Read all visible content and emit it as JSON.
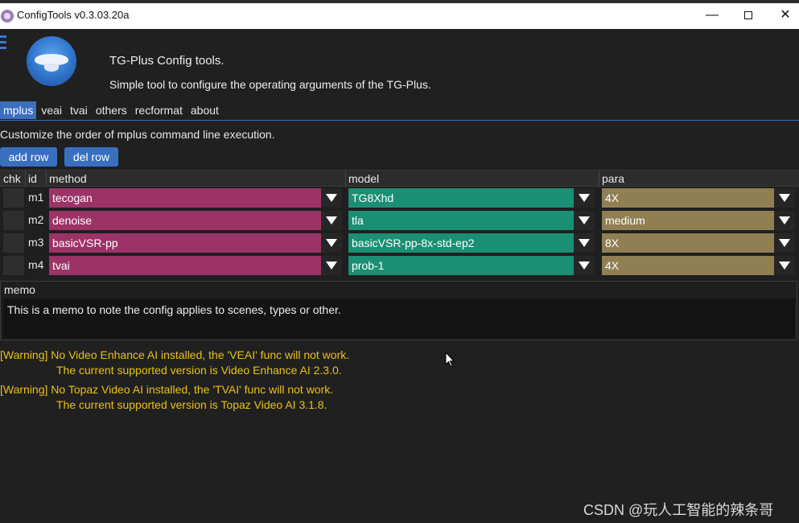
{
  "window": {
    "title": "ConfigTools v0.3.03.20a",
    "minimize": "—",
    "close": "✕"
  },
  "header": {
    "title": "TG-Plus Config tools.",
    "description": "Simple tool to configure the operating arguments of the TG-Plus."
  },
  "tabs": [
    "mplus",
    "veai",
    "tvai",
    "others",
    "recformat",
    "about"
  ],
  "active_tab": "mplus",
  "instruction": "Customize the order of mplus command line execution.",
  "buttons": {
    "add_row": "add row",
    "del_row": "del row"
  },
  "table": {
    "columns": {
      "chk": "chk",
      "id": "id",
      "method": "method",
      "model": "model",
      "para": "para"
    },
    "rows": [
      {
        "id": "m1",
        "method": "tecogan",
        "model": "TG8Xhd",
        "para": "4X"
      },
      {
        "id": "m2",
        "method": "denoise",
        "model": "tla",
        "para": "medium"
      },
      {
        "id": "m3",
        "method": "basicVSR-pp",
        "model": "basicVSR-pp-8x-std-ep2",
        "para": "8X"
      },
      {
        "id": "m4",
        "method": "tvai",
        "model": "prob-1",
        "para": "4X"
      }
    ]
  },
  "memo": {
    "label": "memo",
    "text": "This is a memo to note the config applies to scenes, types or other."
  },
  "warnings": [
    {
      "line1": "[Warning] No Video Enhance AI installed, the 'VEAI' func will not work.",
      "line2": "The current supported version is Video Enhance AI 2.3.0."
    },
    {
      "line1": "[Warning] No Topaz Video AI installed, the 'TVAI' func will not work.",
      "line2": "The current supported version is Topaz Video AI 3.1.8."
    }
  ],
  "watermark": "CSDN @玩人工智能的辣条哥",
  "colors": {
    "accent": "#3c6fbd",
    "method": "#9c3366",
    "model": "#1b8f73",
    "para": "#8f7f52",
    "warning": "#e6c21a"
  }
}
